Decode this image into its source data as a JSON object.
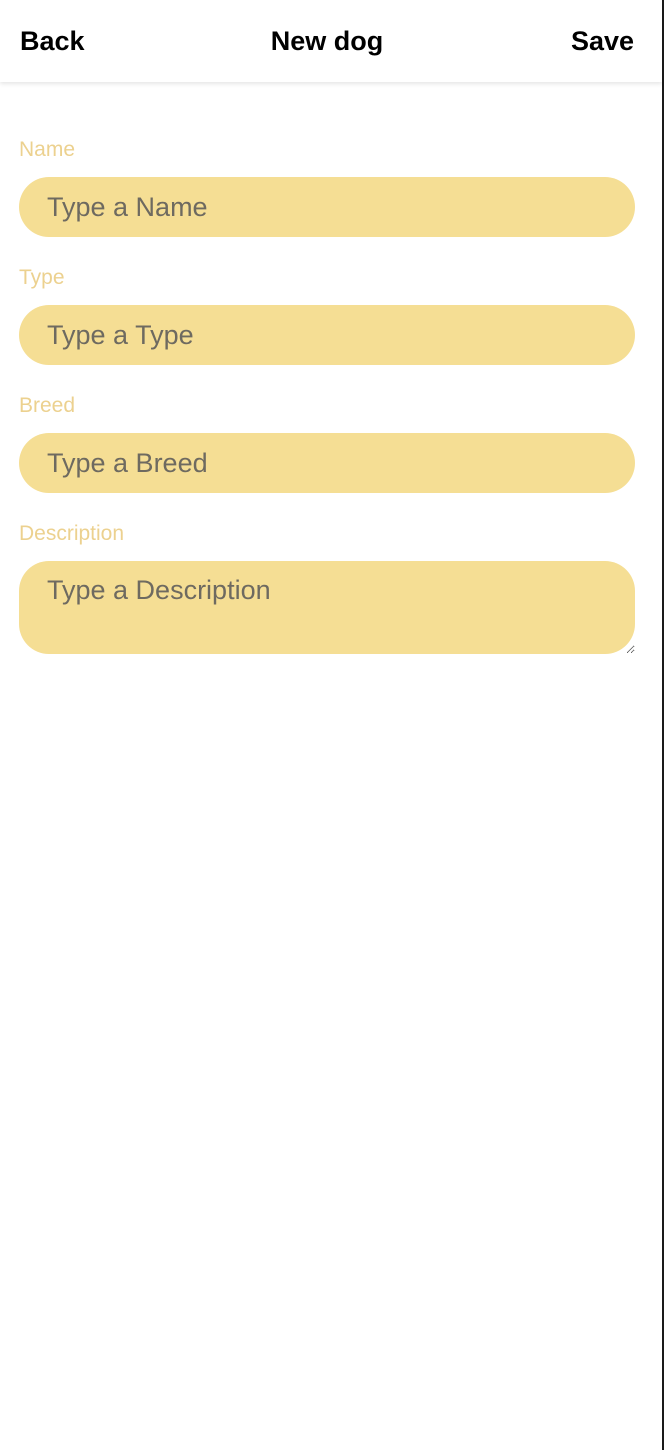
{
  "header": {
    "back_label": "Back",
    "title": "New dog",
    "save_label": "Save"
  },
  "form": {
    "fields": [
      {
        "label": "Name",
        "placeholder": "Type a Name",
        "value": ""
      },
      {
        "label": "Type",
        "placeholder": "Type a Type",
        "value": ""
      },
      {
        "label": "Breed",
        "placeholder": "Type a Breed",
        "value": ""
      },
      {
        "label": "Description",
        "placeholder": "Type a Description",
        "value": ""
      }
    ]
  },
  "colors": {
    "label": "#ecd18f",
    "input_background": "#f5de94",
    "placeholder": "#6e6a60",
    "header_text": "#000000"
  }
}
